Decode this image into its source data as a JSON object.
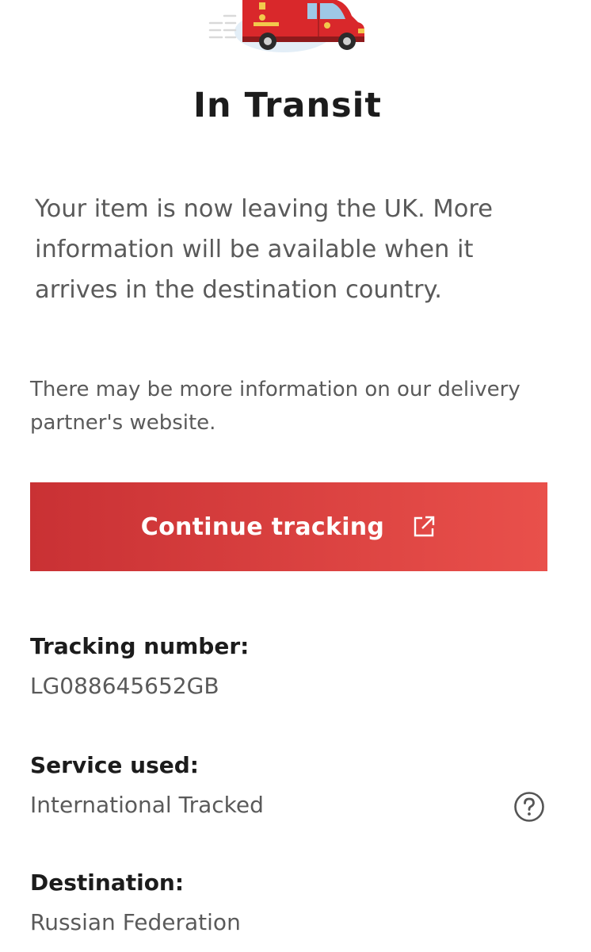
{
  "status": {
    "title": "In Transit",
    "message": "Your item is now leaving the UK. More information will be available when it arrives in the destination country.",
    "partner_note": "There may be more information on our delivery partner's website."
  },
  "actions": {
    "continue_label": "Continue tracking",
    "continue_icon": "external-link-icon"
  },
  "details": {
    "tracking_label": "Tracking number:",
    "tracking_value": "LG088645652GB",
    "service_label": "Service used:",
    "service_value": "International Tracked",
    "service_help_icon": "help-circle-icon",
    "destination_label": "Destination:",
    "destination_value": "Russian Federation"
  },
  "colors": {
    "brand_red": "#da3a3a",
    "button_gradient_start": "#c93134",
    "button_gradient_end": "#e9504b",
    "van_red": "#d9282b",
    "badge_bg": "#e3eef7"
  }
}
